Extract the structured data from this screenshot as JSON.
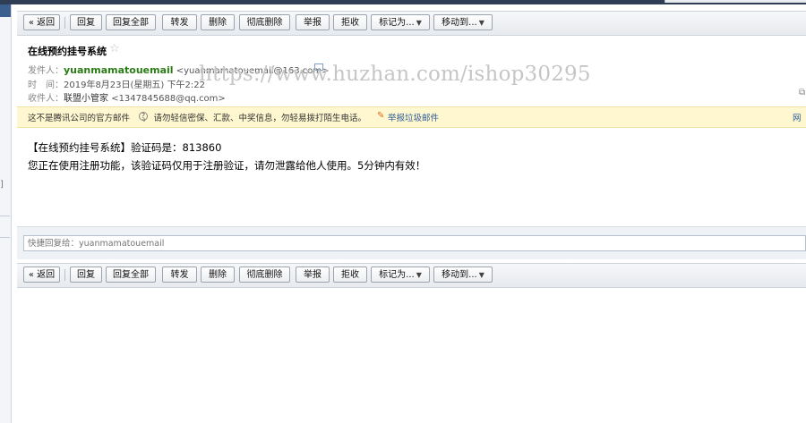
{
  "toolbar": {
    "back": "« 返回",
    "reply": "回复",
    "reply_all": "回复全部",
    "forward": "转发",
    "delete": "删除",
    "delete_forever": "彻底删除",
    "report": "举报",
    "reject": "拒收",
    "mark_as": "标记为...",
    "move_to": "移动到..."
  },
  "mail": {
    "subject": "在线预约挂号系统",
    "star_icon": "star-outline-icon",
    "from_label": "发件人：",
    "from_name": "yuanmamatouemail",
    "from_address": "<yuanmamatouemail@163.com>",
    "time_label": "时　间：",
    "time_value": "2019年8月23日(星期五) 下午2:22",
    "to_label": "收件人：",
    "to_name": "联盟小管家",
    "to_address": "<1347845688@qq.com>"
  },
  "watermark": "https://www.huzhan.com/ishop30295",
  "warning": {
    "text_before": "这不是腾讯公司的官方邮件",
    "text_after": "。 请勿轻信密保、汇款、中奖信息，勿轻易拨打陌生电话。",
    "help_icon": "?",
    "report_link": "举报垃圾邮件",
    "right_text": "网"
  },
  "body": {
    "line1": "【在线预约挂号系统】验证码是：813860",
    "line2": "您正在使用注册功能，该验证码仅用于注册验证，请勿泄露给他人使用。5分钟内有效！"
  },
  "quick_reply": {
    "placeholder": "快捷回复给：yuanmamatouemail"
  },
  "colors": {
    "sender_green": "#2a7d16",
    "warning_bg": "#fff7cf",
    "link_blue": "#2b5b9a"
  }
}
